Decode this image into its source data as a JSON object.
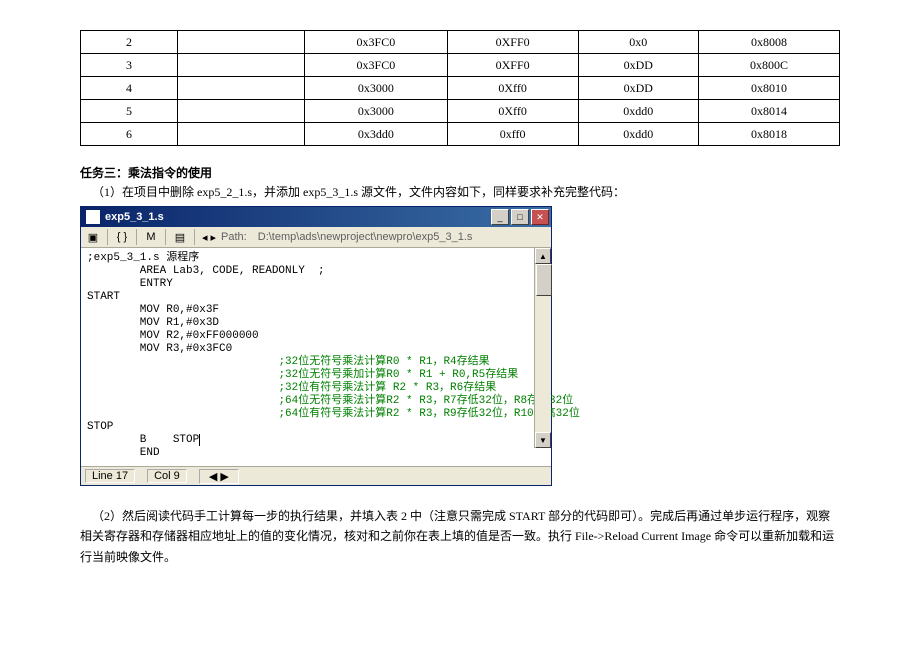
{
  "table": {
    "rows": [
      {
        "idx": "2",
        "c1": "0x3FC0",
        "c2": "0XFF0",
        "c3": "0x0",
        "c4": "0x8008"
      },
      {
        "idx": "3",
        "c1": "0x3FC0",
        "c2": "0XFF0",
        "c3": "0xDD",
        "c4": "0x800C"
      },
      {
        "idx": "4",
        "c1": "0x3000",
        "c2": "0Xff0",
        "c3": "0xDD",
        "c4": "0x8010"
      },
      {
        "idx": "5",
        "c1": "0x3000",
        "c2": "0Xff0",
        "c3": "0xdd0",
        "c4": "0x8014"
      },
      {
        "idx": "6",
        "c1": "0x3dd0",
        "c2": "0xff0",
        "c3": "0xdd0",
        "c4": "0x8018"
      }
    ]
  },
  "taskTitle": "任务三：乘法指令的使用",
  "taskPara1": "（1）在项目中删除 exp5_2_1.s，并添加 exp5_3_1.s 源文件，文件内容如下，同样要求补充完整代码：",
  "editorTitle": "exp5_3_1.s",
  "toolbarPathLabel": "Path:",
  "toolbarPath": "D:\\temp\\ads\\newproject\\newpro\\exp5_3_1.s",
  "code": {
    "l1": ";exp5_3_1.s 源程序",
    "l2": "        AREA Lab3, CODE, READONLY  ;",
    "l3": "        ENTRY",
    "l4": "START",
    "l5": "        MOV R0,#0x3F",
    "l6": "        MOV R1,#0x3D",
    "l7": "        MOV R2,#0xFF000000",
    "l8": "        MOV R3,#0x3FC0",
    "c1": ";32位无符号乘法计算R0 * R1，R4存结果",
    "c2": ";32位无符号乘加计算R0 * R1 + R0,R5存结果",
    "c3": ";32位有符号乘法计算 R2 * R3，R6存结果",
    "c4": ";64位无符号乘法计算R2 * R3，R7存低32位，R8存高32位",
    "c5": ";64位有符号乘法计算R2 * R3，R9存低32位，R10存高32位",
    "l9": "STOP",
    "l10": "        B    STOP",
    "l11": "        END"
  },
  "status": {
    "line": "Line 17",
    "col": "Col 9"
  },
  "glyphs": {
    "brace": "{ }",
    "M": "M",
    "arrowL": "◂ ▸",
    "doc": "▣",
    "min": "_",
    "max": "□",
    "close": "✕",
    "up": "▲",
    "down": "▼",
    "left": "◀",
    "right": "▶"
  },
  "taskPara2": "（2）然后阅读代码手工计算每一步的执行结果，并填入表 2 中（注意只需完成 START 部分的代码即可）。完成后再通过单步运行程序，观察相关寄存器和存储器相应地址上的值的变化情况，核对和之前你在表上填的值是否一致。执行 File->Reload Current Image 命令可以重新加载和运行当前映像文件。"
}
